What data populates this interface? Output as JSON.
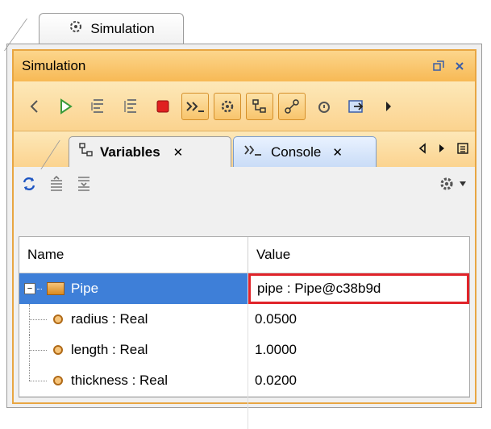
{
  "outer_tab": {
    "label": "Simulation",
    "icon": "gear-icon"
  },
  "panel": {
    "title": "Simulation",
    "header_icons": [
      "restore-icon",
      "close-icon"
    ]
  },
  "toolbar": {
    "buttons": [
      "step-back-icon",
      "run-icon",
      "step-into-icon",
      "step-over-icon",
      "stop-icon",
      "console-toggle-icon",
      "gear-toggle-icon",
      "diagram-toggle-icon",
      "animation-toggle-icon",
      "lock-icon",
      "export-icon",
      "step-forward-icon"
    ]
  },
  "tabs": {
    "variables": {
      "label": "Variables",
      "close": "✕"
    },
    "console": {
      "label": "Console",
      "close": "✕"
    }
  },
  "content_toolbar": {
    "icons": [
      "refresh-icon",
      "export-values-icon",
      "import-values-icon",
      "settings-icon"
    ]
  },
  "table": {
    "headers": {
      "name": "Name",
      "value": "Value"
    },
    "rows": [
      {
        "name": "Pipe",
        "value": "pipe : Pipe@c38b9d",
        "selected": true
      },
      {
        "name": "radius : Real",
        "value": "0.0500"
      },
      {
        "name": "length : Real",
        "value": "1.0000"
      },
      {
        "name": "thickness : Real",
        "value": "0.0200"
      }
    ]
  },
  "colors": {
    "accent_orange": "#f7b955",
    "selection_blue": "#3e7fd8",
    "highlight_red": "#e0242a"
  }
}
